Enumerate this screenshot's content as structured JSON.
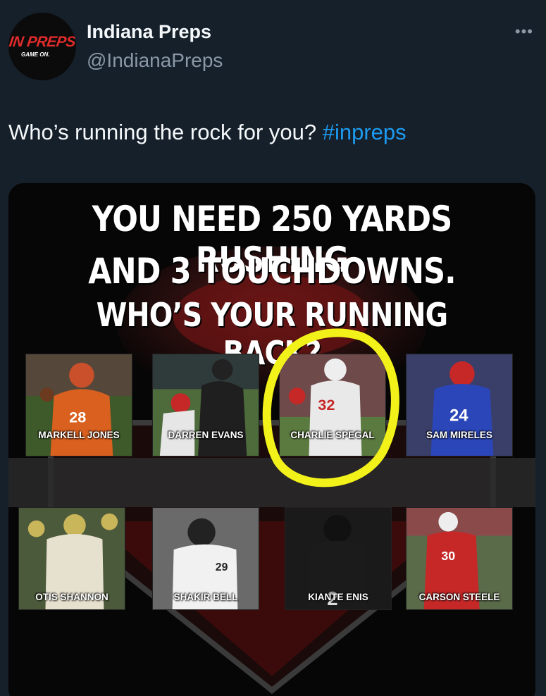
{
  "account": {
    "display_name": "Indiana Preps",
    "handle": "@IndianaPreps",
    "avatar_logo_main": "IN PREPS",
    "avatar_logo_sub": "GAME ON."
  },
  "tweet": {
    "text": "Who’s running the rock for you? ",
    "hashtag": "#inpreps"
  },
  "graphic": {
    "headline_line1": "YOU NEED 250 YARDS RUSHING",
    "headline_line2": "AND 3 TOUCHDOWNS.",
    "headline_line3": "WHO’S YOUR RUNNING BACK?",
    "players_row1": [
      {
        "name": "MARKELL JONES",
        "jersey": "28",
        "color": "#d9601f"
      },
      {
        "name": "DARREN EVANS",
        "jersey": "",
        "color": "#1f1f1f"
      },
      {
        "name": "CHARLIE SPEGAL",
        "jersey": "32",
        "color": "#e9e9ea"
      },
      {
        "name": "SAM MIRELES",
        "jersey": "24",
        "color": "#2b46b8"
      }
    ],
    "players_row2": [
      {
        "name": "OTIS SHANNON",
        "jersey": "",
        "color": "#e6e1cf"
      },
      {
        "name": "SHAKIR BELL",
        "jersey": "29",
        "color": "#f1f1f1"
      },
      {
        "name": "KIANTE ENIS",
        "jersey": "2",
        "color": "#1b1b1b"
      },
      {
        "name": "CARSON STEELE",
        "jersey": "30",
        "color": "#c62828"
      }
    ]
  },
  "icons": {
    "more": "more-horizontal-icon",
    "highlight": "yellow-circle-annotation"
  },
  "colors": {
    "background": "#15202b",
    "hashtag": "#1d9bf0",
    "brand_red": "#e02b2b",
    "highlight_yellow": "#f2f21a"
  }
}
